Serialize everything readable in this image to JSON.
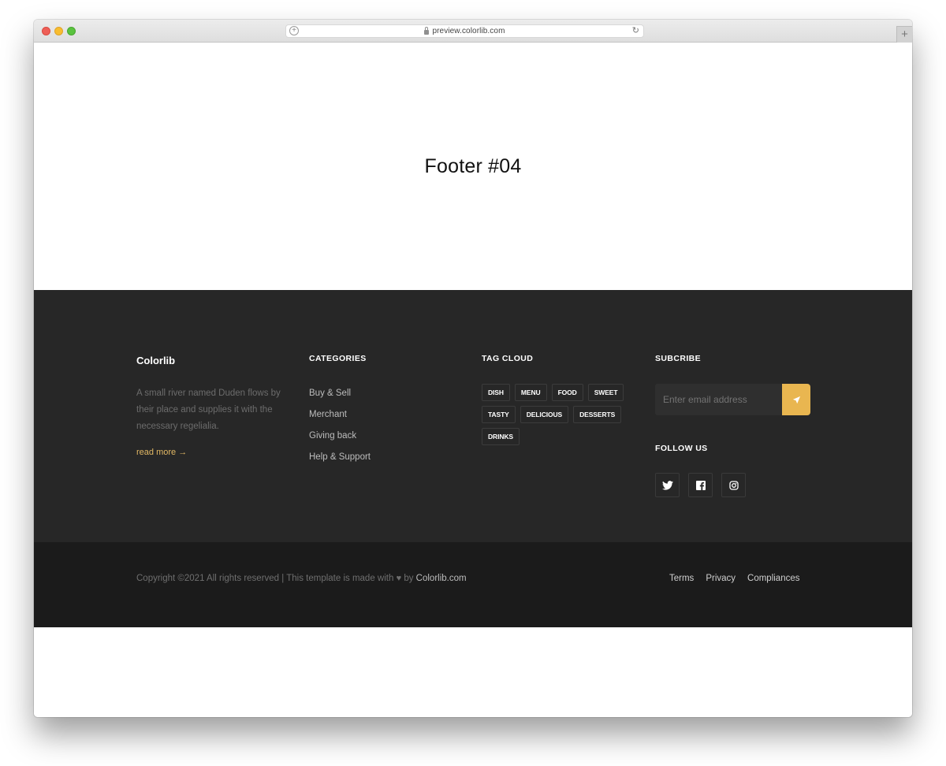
{
  "browser": {
    "url": "preview.colorlib.com",
    "new_tab_label": "+"
  },
  "hero": {
    "title": "Footer #04"
  },
  "footer": {
    "about": {
      "brand": "Colorlib",
      "description": "A small river named Duden flows by their place and supplies it with the necessary regelialia.",
      "read_more": "read more →"
    },
    "categories": {
      "heading": "CATEGORIES",
      "items": [
        "Buy & Sell",
        "Merchant",
        "Giving back",
        "Help & Support"
      ]
    },
    "tag_cloud": {
      "heading": "TAG CLOUD",
      "tags": [
        "DISH",
        "MENU",
        "FOOD",
        "SWEET",
        "TASTY",
        "DELICIOUS",
        "DESSERTS",
        "DRINKS"
      ]
    },
    "subscribe": {
      "heading": "SUBCRIBE",
      "email_placeholder": "Enter email address",
      "email_value": "",
      "button_icon": "paper-plane-icon"
    },
    "follow": {
      "heading": "FOLLOW US",
      "networks": [
        "twitter",
        "facebook",
        "instagram"
      ]
    },
    "bottom": {
      "copyright_prefix": "Copyright ©2021 All rights reserved | This template is made with",
      "copyright_by": "by",
      "copyright_link": "Colorlib.com",
      "links": [
        "Terms",
        "Privacy",
        "Compliances"
      ]
    }
  },
  "colors": {
    "accent": "#e9b650",
    "footer_bg": "#272727",
    "footer_bottom_bg": "#1b1b1b",
    "read_more": "#e2b864"
  }
}
